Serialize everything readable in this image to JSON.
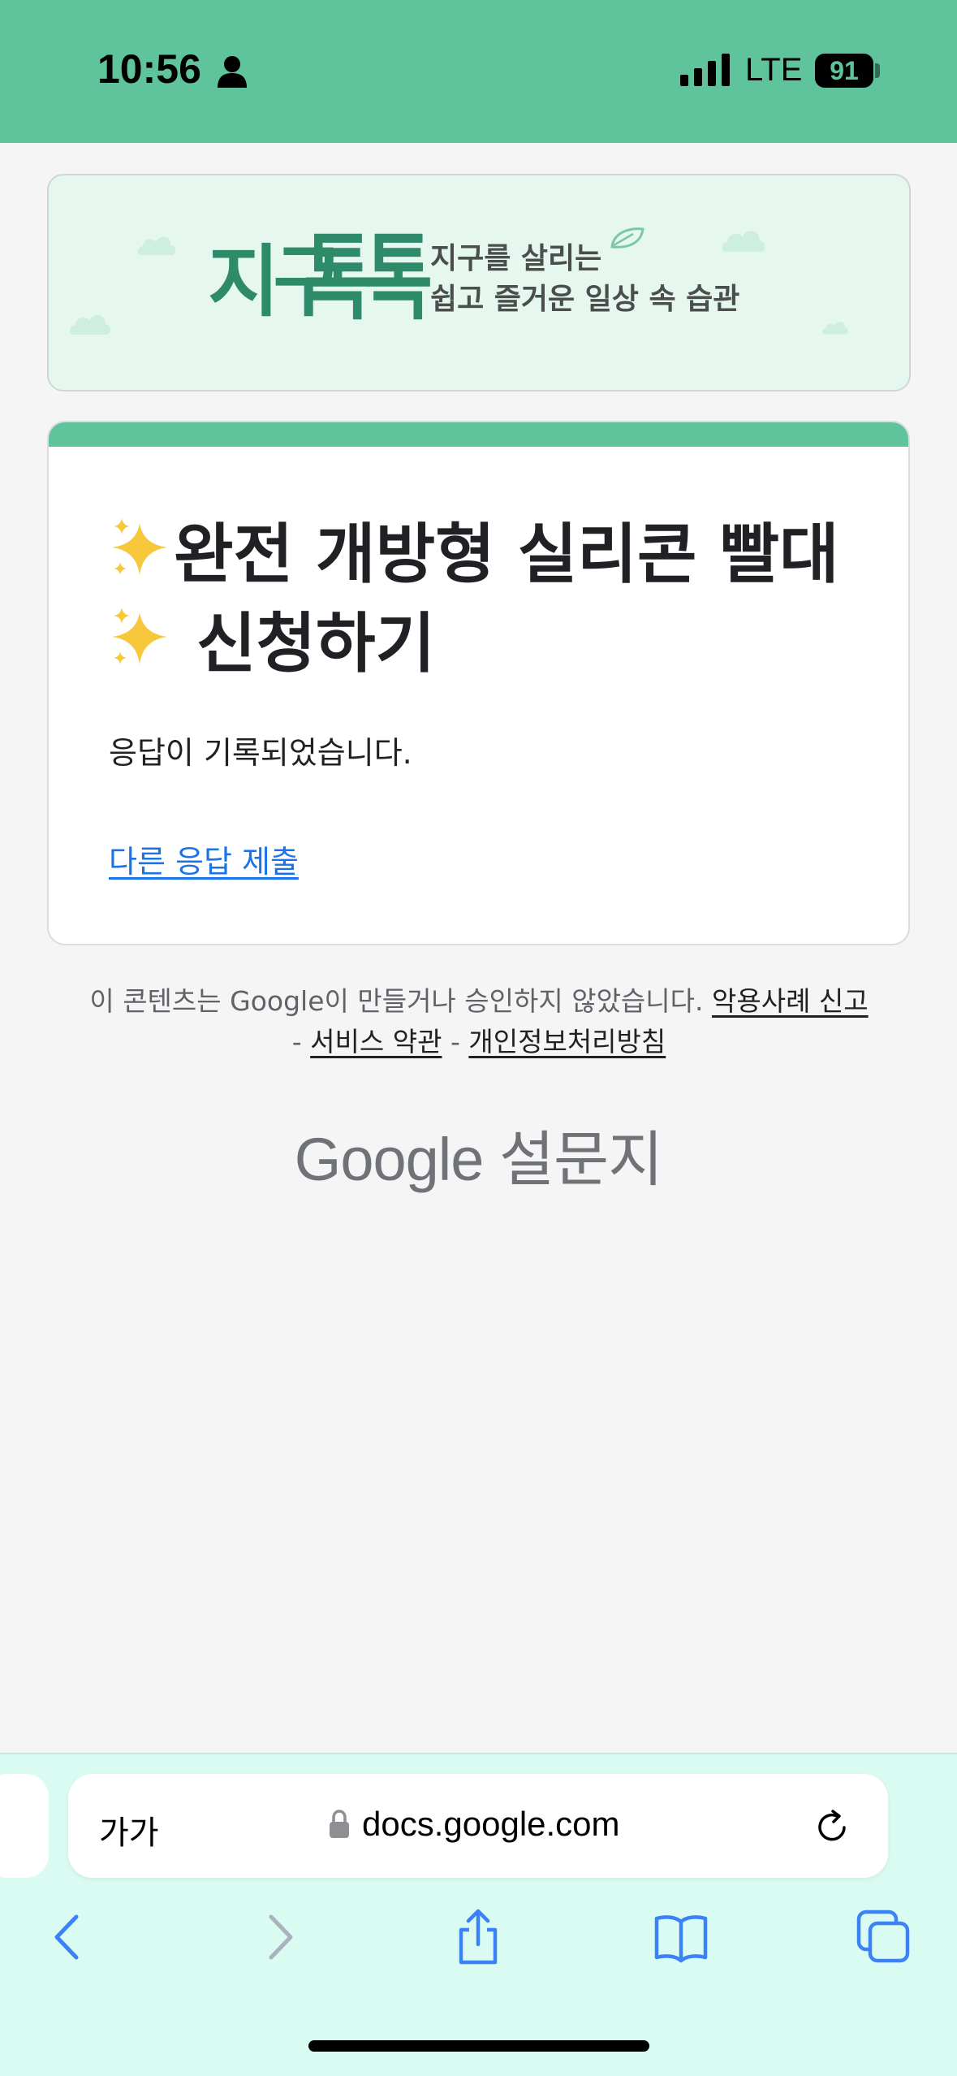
{
  "status_bar": {
    "time": "10:56",
    "network": "LTE",
    "battery": "91",
    "background_color": "#5fc39c"
  },
  "banner": {
    "logo_text": "지구톡톡",
    "tagline_line1": "지구를 살리는",
    "tagline_line2": "쉽고 즐거운 일상 속 습관"
  },
  "form": {
    "title_line1": "완전 개방형 실리콘 빨대",
    "title_line2": "신청하기",
    "title_icon": "sparkles-icon",
    "confirmation": "응답이 기록되었습니다.",
    "resubmit_link": "다른 응답 제출",
    "accent_color": "#5fc39c"
  },
  "footer": {
    "disclaimer": "이 콘텐츠는 Google이 만들거나 승인하지 않았습니다.",
    "report_abuse": "악용사례 신고",
    "terms": "서비스 약관",
    "privacy": "개인정보처리방침",
    "separator": "-",
    "brand_google": "Google",
    "brand_forms": "설문지"
  },
  "browser": {
    "text_size_label": "가가",
    "url": "docs.google.com",
    "toolbar_icons": [
      "back-icon",
      "forward-icon",
      "share-icon",
      "bookmarks-icon",
      "tabs-icon"
    ]
  }
}
